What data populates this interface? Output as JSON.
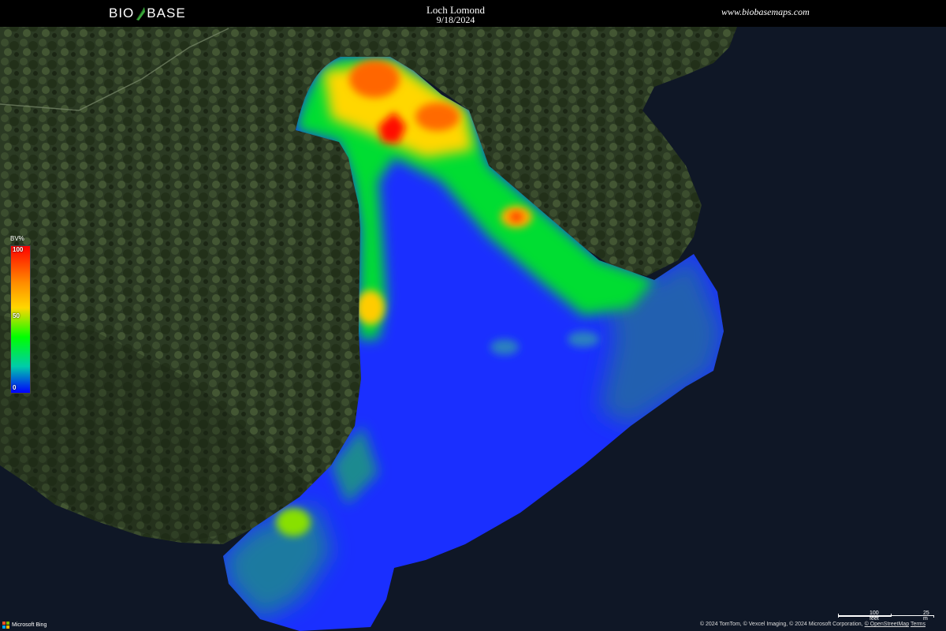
{
  "header": {
    "logo_left": "BIO",
    "logo_right": "BASE",
    "title": "Loch Lomond",
    "date": "9/18/2024",
    "website": "www.biobasemaps.com"
  },
  "legend": {
    "unit": "BV%",
    "max": "100",
    "mid": "50",
    "min": "0",
    "colors": [
      "#ff0000",
      "#ff8c00",
      "#ffd700",
      "#00ff00",
      "#00ccaa",
      "#0000ff"
    ]
  },
  "footer": {
    "provider": "Microsoft Bing",
    "attribution_text": "© 2024 TomTom, © Vexcel Imaging, © 2024 Microsoft Corporation,",
    "attribution_link": "© OpenStreetMap",
    "terms": "Terms",
    "scale_ft": "100 feet",
    "scale_m": "25 m"
  },
  "colors": {
    "header_bg": "#000000",
    "water": "#0f1726",
    "forest": "#2a3a22",
    "open_water_survey": "#0000ff"
  }
}
